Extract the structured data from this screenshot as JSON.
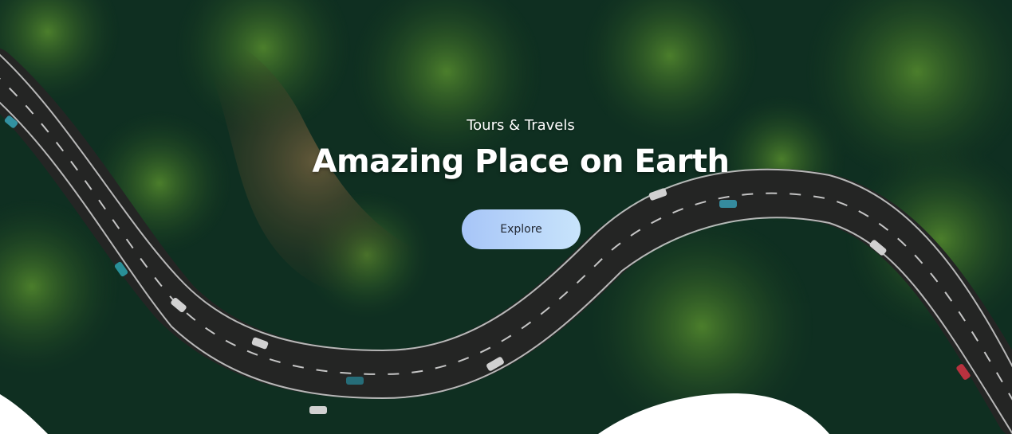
{
  "hero": {
    "subtitle": "Tours & Travels",
    "title": "Amazing Place on Earth",
    "explore_label": "Explore"
  },
  "colors": {
    "forest_dark": "#0c2a1f",
    "forest_mid": "#1f5a2c",
    "forest_light": "#4c8f2f",
    "road": "#2a2b2a",
    "button_start": "#a7c5f8",
    "button_end": "#c8e4fb",
    "wave": "#ffffff"
  }
}
